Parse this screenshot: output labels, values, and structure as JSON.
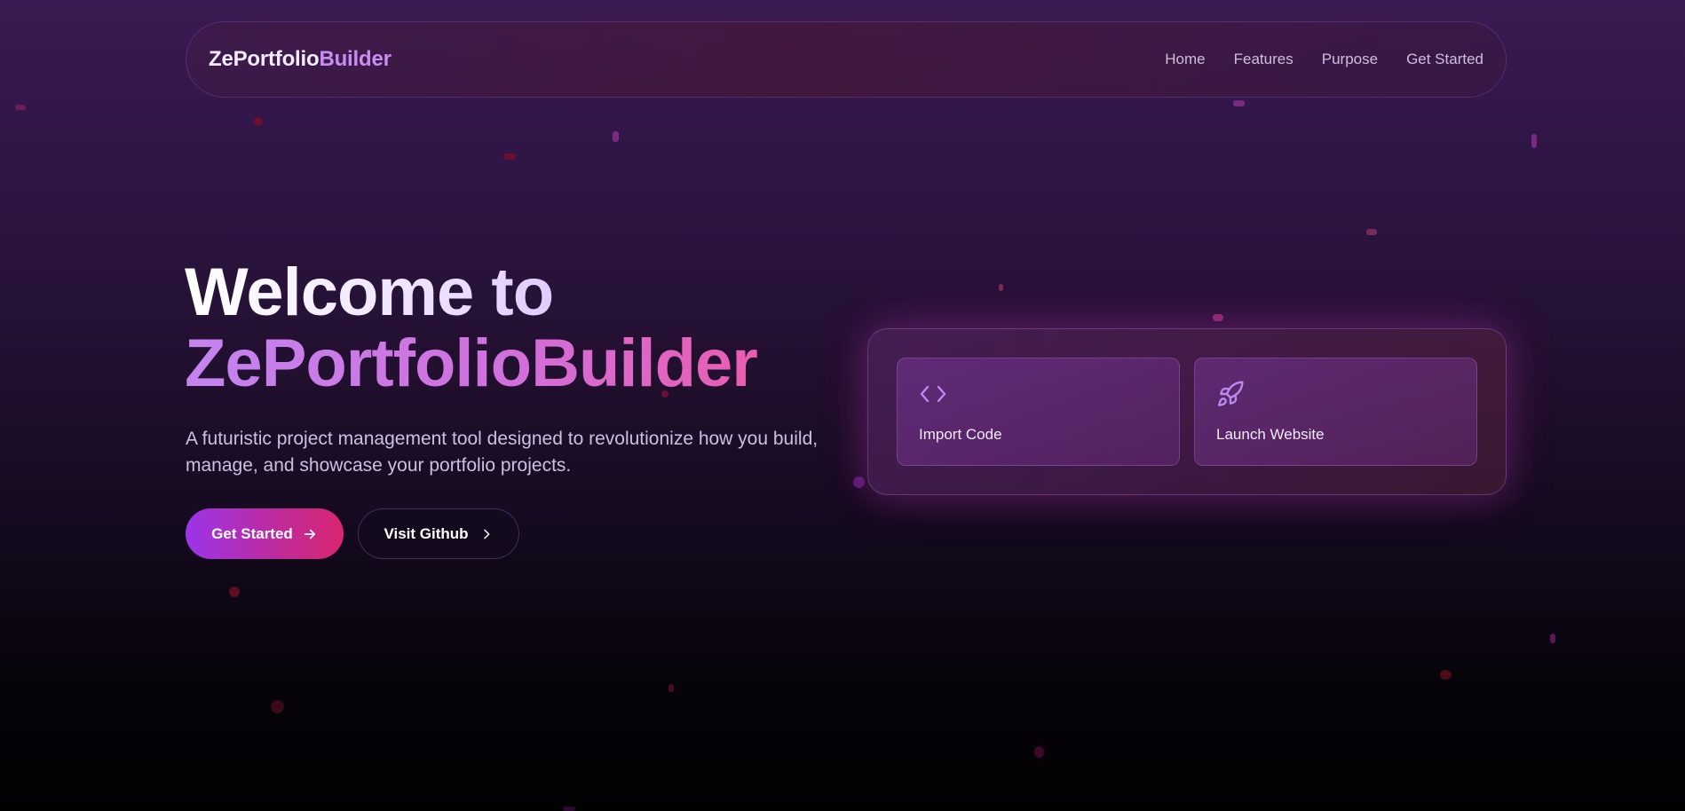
{
  "nav": {
    "brand_part1": "Ze",
    "brand_part2": "Portfolio",
    "brand_part3": "Builder",
    "links": [
      "Home",
      "Features",
      "Purpose",
      "Get Started"
    ]
  },
  "hero": {
    "title_line1": "Welcome to",
    "title_line2": "ZePortfolioBuilder",
    "subtitle": "A futuristic project management tool designed to revolutionize how you build, manage, and showcase your portfolio projects.",
    "primary_button": "Get Started",
    "secondary_button": "Visit Github"
  },
  "features": [
    {
      "label": "Import Code",
      "icon": "code-icon"
    },
    {
      "label": "Launch Website",
      "icon": "rocket-icon"
    }
  ],
  "colors": {
    "accent_purple": "#9b35e8",
    "accent_pink": "#d9266f",
    "icon_purple": "#b98bf0"
  }
}
